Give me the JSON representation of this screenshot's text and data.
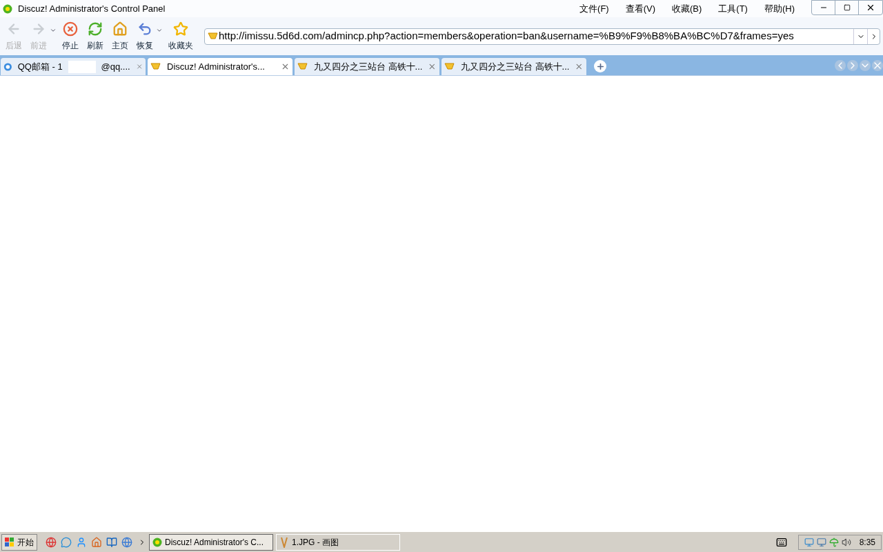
{
  "window": {
    "title": "Discuz! Administrator's Control Panel"
  },
  "menu": [
    "文件(F)",
    "查看(V)",
    "收藏(B)",
    "工具(T)",
    "帮助(H)"
  ],
  "toolbar": [
    {
      "kind": "back",
      "label": "后退",
      "disabled": true,
      "dropdown": false
    },
    {
      "kind": "forward",
      "label": "前进",
      "disabled": true,
      "dropdown": true
    },
    {
      "kind": "stop",
      "label": "停止",
      "disabled": false,
      "dropdown": false
    },
    {
      "kind": "refresh",
      "label": "刷新",
      "disabled": false,
      "dropdown": false
    },
    {
      "kind": "home",
      "label": "主页",
      "disabled": false,
      "dropdown": false
    },
    {
      "kind": "restore",
      "label": "恢复",
      "disabled": false,
      "dropdown": true
    },
    {
      "kind": "favorites",
      "label": "收藏夹",
      "disabled": false,
      "dropdown": false
    }
  ],
  "address": {
    "value": "http://imissu.5d6d.com/admincp.php?action=members&operation=ban&username=%B9%F9%B8%BA%BC%D7&frames=yes"
  },
  "tabs": [
    {
      "kind": "mail",
      "title": "QQ邮箱 - 1",
      "title_end": "@qq....",
      "selected": false
    },
    {
      "kind": "site",
      "title": "Discuz! Administrator's...",
      "selected": true
    },
    {
      "kind": "site",
      "title": "九又四分之三站台 高铁十...",
      "selected": false
    },
    {
      "kind": "site",
      "title": "九又四分之三站台 高铁十...",
      "selected": false
    }
  ],
  "taskbar": {
    "start": "开始",
    "tasks": [
      {
        "kind": "browser",
        "title": "Discuz! Administrator's C...",
        "selected": true
      },
      {
        "kind": "paint",
        "title": "1.JPG - 画图",
        "selected": false
      }
    ],
    "clock": "8:35"
  }
}
